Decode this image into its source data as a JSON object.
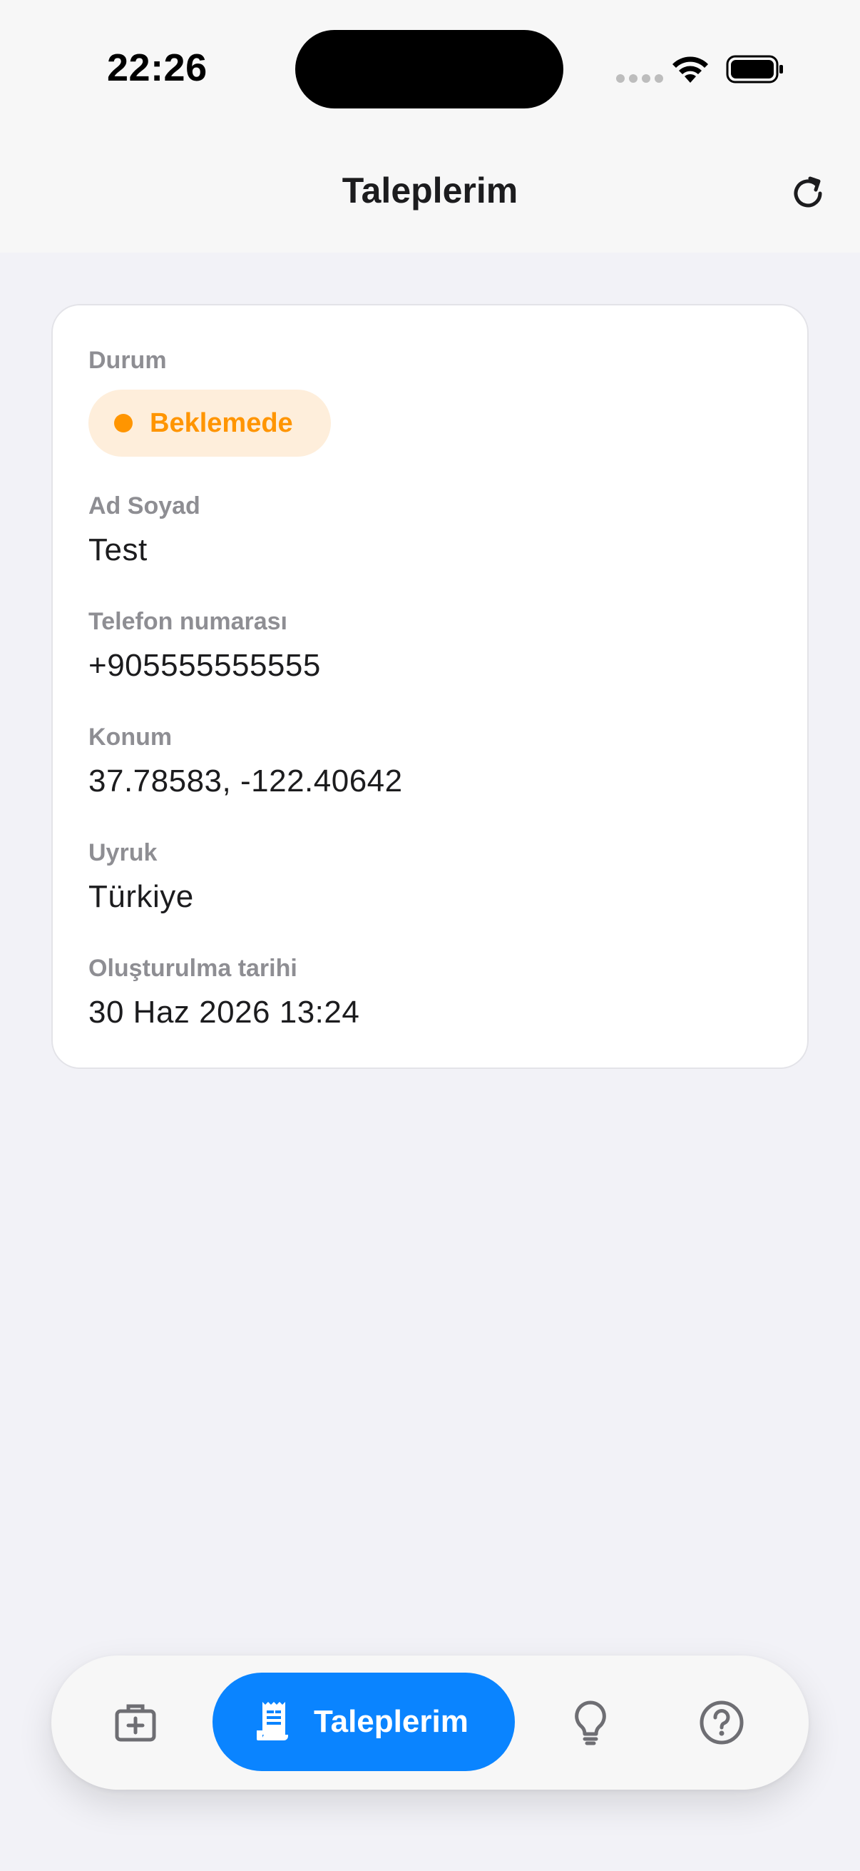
{
  "status_bar": {
    "time": "22:26"
  },
  "header": {
    "title": "Taleplerim",
    "refresh_icon": "refresh-icon"
  },
  "request": {
    "status_label": "Durum",
    "status_value": "Beklemede",
    "status_color": "#FF9500",
    "name_label": "Ad Soyad",
    "name_value": "Test",
    "phone_label": "Telefon numarası",
    "phone_value": "+905555555555",
    "location_label": "Konum",
    "location_value": "37.78583, -122.40642",
    "nationality_label": "Uyruk",
    "nationality_value": "Türkiye",
    "created_label": "Oluşturulma tarihi",
    "created_value": "30 Haz 2026 13:24"
  },
  "tabbar": {
    "active_label": "Taleplerim",
    "active_color": "#0A84FF",
    "tabs": [
      {
        "icon": "medical-kit-icon"
      },
      {
        "icon": "receipt-icon"
      },
      {
        "icon": "lightbulb-icon"
      },
      {
        "icon": "help-circle-icon"
      }
    ]
  }
}
